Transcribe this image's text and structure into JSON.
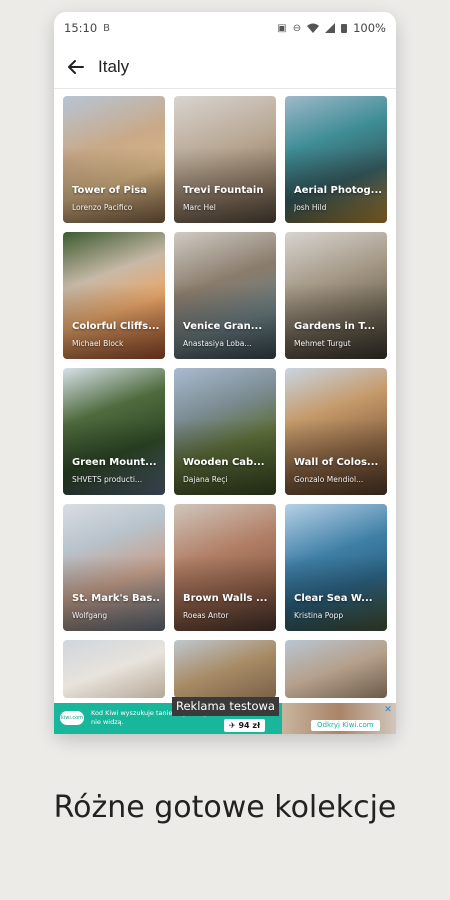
{
  "status_bar": {
    "time": "15:10",
    "left_icon": "B",
    "battery": "100%"
  },
  "app_bar": {
    "title": "Italy",
    "back_icon": "arrow-left-icon"
  },
  "cards": [
    {
      "title": "Tower of Pisa",
      "author": "Lorenzo Pacifico"
    },
    {
      "title": "Trevi Fountain",
      "author": "Marc Hel"
    },
    {
      "title": "Aerial Photog...",
      "author": "Josh Hild"
    },
    {
      "title": "Colorful Cliffs...",
      "author": "Michael Block"
    },
    {
      "title": "Venice Gran...",
      "author": "Anastasiya Loba..."
    },
    {
      "title": "Gardens in T...",
      "author": "Mehmet Turgut"
    },
    {
      "title": "Green Mount...",
      "author": "SHVETS producti..."
    },
    {
      "title": "Wooden Cab...",
      "author": "Dajana Reçi"
    },
    {
      "title": "Wall of Colos...",
      "author": "Gonzalo Mendiol..."
    },
    {
      "title": "St. Mark's Bas...",
      "author": "Wolfgang"
    },
    {
      "title": "Brown Walls ...",
      "author": "Roeas Antor"
    },
    {
      "title": "Clear Sea W...",
      "author": "Kristina Popp"
    }
  ],
  "ad": {
    "label": "Reklama testowa",
    "logo_text": "kiwi.com",
    "text": "Kod Kiwi wyszukuje tanie loty, których inni nie widzą.",
    "price": "✈ 94 zł",
    "cta": "Odkryj Kiwi.com",
    "close": "✕"
  },
  "tagline": "Różne gotowe kolekcje"
}
